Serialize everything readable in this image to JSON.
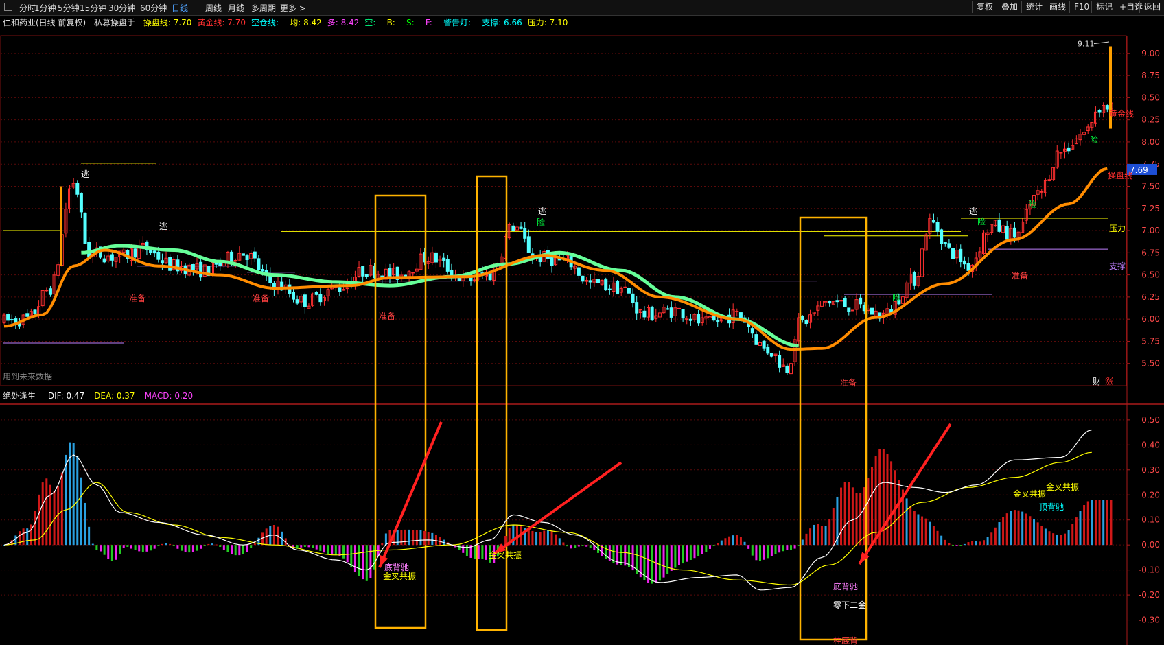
{
  "toolbar": {
    "left_items": [
      "分时",
      "1分钟",
      "5分钟",
      "15分钟",
      "30分钟",
      "60分钟",
      "日线",
      "周线",
      "月线",
      "多周期",
      "更多 >"
    ],
    "active_item": "日线",
    "right_items": [
      "复权",
      "叠加",
      "统计",
      "画线",
      "F10",
      "标记",
      "+自选",
      "返回"
    ]
  },
  "header": {
    "stock": "仁和药业(日线 前复权)",
    "indicator": "私募操盘手",
    "items": [
      {
        "text": "操盘线: 7.70",
        "color": "#ffff00"
      },
      {
        "text": "黄金线: 7.70",
        "color": "#ff3030"
      },
      {
        "text": "空仓线: -",
        "color": "#00ffff"
      },
      {
        "text": "均: 8.42",
        "color": "#ffff00"
      },
      {
        "text": "多: 8.42",
        "color": "#ff44ff"
      },
      {
        "text": "空: -",
        "color": "#00ff80"
      },
      {
        "text": "B: -",
        "color": "#ffff00"
      },
      {
        "text": "S: -",
        "color": "#00ff00"
      },
      {
        "text": "F: -",
        "color": "#ff44ff"
      },
      {
        "text": "警告灯: -",
        "color": "#00ffff"
      },
      {
        "text": "支撑: 6.66",
        "color": "#00ffff"
      },
      {
        "text": "压力: 7.10",
        "color": "#ffff00"
      }
    ],
    "note": "用到未来数据"
  },
  "macd_header": {
    "name": "绝处逢生",
    "items": [
      {
        "text": "DIF: 0.47",
        "color": "#ffffff"
      },
      {
        "text": "DEA: 0.37",
        "color": "#ffff00"
      },
      {
        "text": "MACD: 0.20",
        "color": "#ff44ff"
      }
    ]
  },
  "price_axis": {
    "ticks": [
      "9.00",
      "8.75",
      "8.50",
      "8.25",
      "8.00",
      "7.75",
      "7.50",
      "7.25",
      "7.00",
      "6.75",
      "6.50",
      "6.25",
      "6.00",
      "5.75",
      "5.50"
    ],
    "last_price": "7.69",
    "high_label": "9.11"
  },
  "macd_axis": {
    "ticks": [
      "0.50",
      "0.40",
      "0.30",
      "0.20",
      "0.10",
      "0.00",
      "-0.10",
      "-0.20",
      "-0.30"
    ]
  },
  "badges": {
    "cai": "财",
    "zhang": "涨"
  },
  "labels": {
    "tao": "逃",
    "xian": "险",
    "zhunbei": "准备",
    "yali": "压力",
    "zhicheng": "支撑",
    "caopan": "操盘线",
    "huangjin": "黄金线",
    "dibei": "底背驰",
    "jinsha": "金叉共振",
    "lingxia": "零下二金",
    "dingbei": "顶背驰",
    "zhudibei": "柱底背"
  },
  "chart_data": {
    "type": "candlestick",
    "colors": {
      "up": "#ff3030",
      "down": "#54ffff",
      "ma_fast": "#ff8c00",
      "ma_slow": "#66ff99",
      "dif": "#ffffff",
      "dea": "#ffff00",
      "hist_up": "#d01818",
      "hist_down": "#2aa0e0",
      "hist_neg": "#22cc22",
      "hist_neg2": "#ee22ee"
    },
    "price_range": [
      5.25,
      9.2
    ],
    "macd_range": [
      -0.4,
      0.56
    ],
    "anchors": [
      [
        0,
        5.98
      ],
      [
        6,
        6.0
      ],
      [
        12,
        6.35
      ],
      [
        18,
        7.55
      ],
      [
        22,
        6.75
      ],
      [
        30,
        6.7
      ],
      [
        36,
        6.8
      ],
      [
        44,
        6.6
      ],
      [
        52,
        6.55
      ],
      [
        62,
        6.75
      ],
      [
        70,
        6.4
      ],
      [
        78,
        6.2
      ],
      [
        86,
        6.35
      ],
      [
        94,
        6.55
      ],
      [
        102,
        6.5
      ],
      [
        110,
        6.7
      ],
      [
        120,
        6.45
      ],
      [
        126,
        6.5
      ],
      [
        132,
        7.05
      ],
      [
        138,
        6.7
      ],
      [
        146,
        6.65
      ],
      [
        152,
        6.4
      ],
      [
        160,
        6.35
      ],
      [
        166,
        6.05
      ],
      [
        174,
        6.1
      ],
      [
        182,
        5.95
      ],
      [
        190,
        6.05
      ],
      [
        198,
        5.65
      ],
      [
        203,
        5.45
      ],
      [
        206,
        5.95
      ],
      [
        214,
        6.2
      ],
      [
        220,
        6.15
      ],
      [
        228,
        6.05
      ],
      [
        236,
        6.45
      ],
      [
        240,
        7.1
      ],
      [
        246,
        6.75
      ],
      [
        250,
        6.6
      ],
      [
        256,
        7.05
      ],
      [
        262,
        6.95
      ],
      [
        268,
        7.4
      ],
      [
        274,
        7.9
      ],
      [
        280,
        8.1
      ],
      [
        284,
        8.4
      ]
    ],
    "ma_fast_anchors": [
      [
        0,
        5.92
      ],
      [
        10,
        6.05
      ],
      [
        18,
        6.6
      ],
      [
        26,
        6.78
      ],
      [
        40,
        6.6
      ],
      [
        56,
        6.5
      ],
      [
        70,
        6.35
      ],
      [
        90,
        6.38
      ],
      [
        100,
        6.47
      ],
      [
        120,
        6.48
      ],
      [
        140,
        6.72
      ],
      [
        156,
        6.55
      ],
      [
        170,
        6.25
      ],
      [
        190,
        6.0
      ],
      [
        204,
        5.66
      ],
      [
        212,
        5.67
      ],
      [
        226,
        6.02
      ],
      [
        244,
        6.4
      ],
      [
        262,
        6.9
      ],
      [
        276,
        7.3
      ],
      [
        286,
        7.7
      ]
    ],
    "ma_slow_anchors": [
      [
        20,
        6.75
      ],
      [
        30,
        6.83
      ],
      [
        44,
        6.78
      ],
      [
        56,
        6.65
      ],
      [
        70,
        6.5
      ],
      [
        86,
        6.42
      ],
      [
        100,
        6.38
      ],
      [
        116,
        6.48
      ],
      [
        130,
        6.62
      ],
      [
        144,
        6.75
      ],
      [
        160,
        6.55
      ],
      [
        174,
        6.25
      ],
      [
        190,
        6.0
      ],
      [
        206,
        5.7
      ]
    ],
    "macd_dif_anchors": [
      [
        0,
        0.0
      ],
      [
        6,
        0.05
      ],
      [
        12,
        0.2
      ],
      [
        18,
        0.36
      ],
      [
        24,
        0.24
      ],
      [
        30,
        0.13
      ],
      [
        40,
        0.09
      ],
      [
        52,
        0.04
      ],
      [
        62,
        0.0
      ],
      [
        70,
        0.04
      ],
      [
        76,
        -0.02
      ],
      [
        86,
        -0.06
      ],
      [
        94,
        -0.1
      ],
      [
        100,
        0.01
      ],
      [
        110,
        0.02
      ],
      [
        120,
        -0.01
      ],
      [
        126,
        0.02
      ],
      [
        132,
        0.12
      ],
      [
        140,
        0.09
      ],
      [
        148,
        0.04
      ],
      [
        160,
        -0.07
      ],
      [
        170,
        -0.15
      ],
      [
        180,
        -0.13
      ],
      [
        190,
        -0.12
      ],
      [
        196,
        -0.18
      ],
      [
        204,
        -0.17
      ],
      [
        212,
        -0.05
      ],
      [
        220,
        0.1
      ],
      [
        228,
        0.25
      ],
      [
        236,
        0.23
      ],
      [
        244,
        0.21
      ],
      [
        252,
        0.24
      ],
      [
        262,
        0.34
      ],
      [
        274,
        0.35
      ],
      [
        282,
        0.46
      ]
    ],
    "macd_dea_anchors": [
      [
        0,
        0.0
      ],
      [
        8,
        0.02
      ],
      [
        16,
        0.14
      ],
      [
        24,
        0.25
      ],
      [
        32,
        0.13
      ],
      [
        44,
        0.08
      ],
      [
        56,
        0.03
      ],
      [
        70,
        0.0
      ],
      [
        86,
        -0.04
      ],
      [
        100,
        -0.02
      ],
      [
        116,
        0.0
      ],
      [
        132,
        0.08
      ],
      [
        146,
        0.05
      ],
      [
        160,
        -0.03
      ],
      [
        176,
        -0.1
      ],
      [
        190,
        -0.14
      ],
      [
        204,
        -0.16
      ],
      [
        214,
        -0.08
      ],
      [
        226,
        0.05
      ],
      [
        238,
        0.17
      ],
      [
        250,
        0.23
      ],
      [
        262,
        0.27
      ],
      [
        274,
        0.33
      ],
      [
        282,
        0.37
      ]
    ]
  }
}
